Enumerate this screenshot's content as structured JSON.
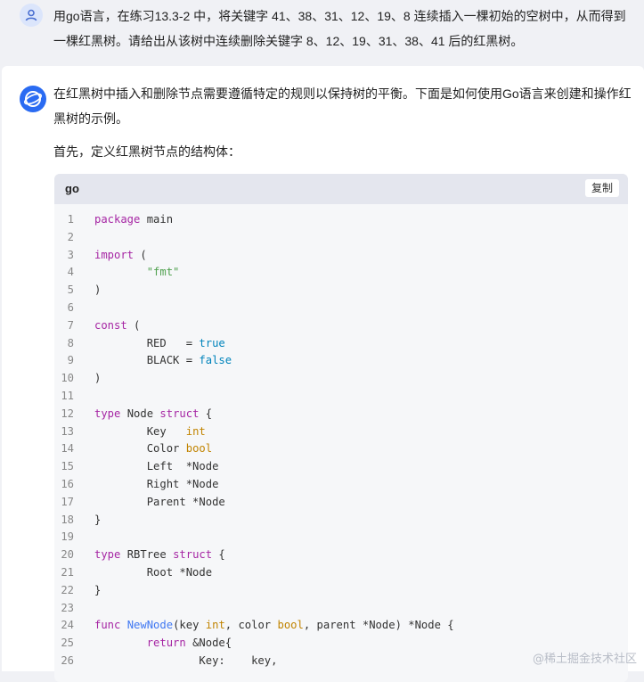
{
  "user_message": {
    "avatar_icon": "user-icon",
    "text": "用go语言，在练习13.3-2 中，将关键字 41、38、31、12、19、8 连续插入一棵初始的空树中，从而得到一棵红黑树。请给出从该树中连续删除关键字 8、12、19、31、38、41 后的红黑树。"
  },
  "bot_message": {
    "avatar_icon": "assistant-logo-icon",
    "intro": "在红黑树中插入和删除节点需要遵循特定的规则以保持树的平衡。下面是如何使用Go语言来创建和操作红黑树的示例。",
    "intro2": "首先，定义红黑树节点的结构体："
  },
  "code_block": {
    "language": "go",
    "copy_label": "复制",
    "lines": [
      {
        "n": "1",
        "tokens": [
          {
            "t": "package",
            "c": "kw"
          },
          {
            "t": " main",
            "c": "p"
          }
        ]
      },
      {
        "n": "2",
        "tokens": []
      },
      {
        "n": "3",
        "tokens": [
          {
            "t": "import",
            "c": "kw"
          },
          {
            "t": " (",
            "c": "p"
          }
        ]
      },
      {
        "n": "4",
        "tokens": [
          {
            "t": "        ",
            "c": "p"
          },
          {
            "t": "\"fmt\"",
            "c": "str"
          }
        ]
      },
      {
        "n": "5",
        "tokens": [
          {
            "t": ")",
            "c": "p"
          }
        ]
      },
      {
        "n": "6",
        "tokens": []
      },
      {
        "n": "7",
        "tokens": [
          {
            "t": "const",
            "c": "kw"
          },
          {
            "t": " (",
            "c": "p"
          }
        ]
      },
      {
        "n": "8",
        "tokens": [
          {
            "t": "        RED   = ",
            "c": "p"
          },
          {
            "t": "true",
            "c": "bool"
          }
        ]
      },
      {
        "n": "9",
        "tokens": [
          {
            "t": "        BLACK = ",
            "c": "p"
          },
          {
            "t": "false",
            "c": "bool"
          }
        ]
      },
      {
        "n": "10",
        "tokens": [
          {
            "t": ")",
            "c": "p"
          }
        ]
      },
      {
        "n": "11",
        "tokens": []
      },
      {
        "n": "12",
        "tokens": [
          {
            "t": "type",
            "c": "kw"
          },
          {
            "t": " Node ",
            "c": "p"
          },
          {
            "t": "struct",
            "c": "kw"
          },
          {
            "t": " {",
            "c": "p"
          }
        ]
      },
      {
        "n": "13",
        "tokens": [
          {
            "t": "        Key   ",
            "c": "p"
          },
          {
            "t": "int",
            "c": "type"
          }
        ]
      },
      {
        "n": "14",
        "tokens": [
          {
            "t": "        Color ",
            "c": "p"
          },
          {
            "t": "bool",
            "c": "type"
          }
        ]
      },
      {
        "n": "15",
        "tokens": [
          {
            "t": "        Left  *Node",
            "c": "p"
          }
        ]
      },
      {
        "n": "16",
        "tokens": [
          {
            "t": "        Right *Node",
            "c": "p"
          }
        ]
      },
      {
        "n": "17",
        "tokens": [
          {
            "t": "        Parent *Node",
            "c": "p"
          }
        ]
      },
      {
        "n": "18",
        "tokens": [
          {
            "t": "}",
            "c": "p"
          }
        ]
      },
      {
        "n": "19",
        "tokens": []
      },
      {
        "n": "20",
        "tokens": [
          {
            "t": "type",
            "c": "kw"
          },
          {
            "t": " RBTree ",
            "c": "p"
          },
          {
            "t": "struct",
            "c": "kw"
          },
          {
            "t": " {",
            "c": "p"
          }
        ]
      },
      {
        "n": "21",
        "tokens": [
          {
            "t": "        Root *Node",
            "c": "p"
          }
        ]
      },
      {
        "n": "22",
        "tokens": [
          {
            "t": "}",
            "c": "p"
          }
        ]
      },
      {
        "n": "23",
        "tokens": []
      },
      {
        "n": "24",
        "tokens": [
          {
            "t": "func",
            "c": "kw"
          },
          {
            "t": " ",
            "c": "p"
          },
          {
            "t": "NewNode",
            "c": "fn"
          },
          {
            "t": "(key ",
            "c": "p"
          },
          {
            "t": "int",
            "c": "type"
          },
          {
            "t": ", color ",
            "c": "p"
          },
          {
            "t": "bool",
            "c": "type"
          },
          {
            "t": ", parent *Node) *Node {",
            "c": "p"
          }
        ]
      },
      {
        "n": "25",
        "tokens": [
          {
            "t": "        ",
            "c": "p"
          },
          {
            "t": "return",
            "c": "kw"
          },
          {
            "t": " &Node{",
            "c": "p"
          }
        ]
      },
      {
        "n": "26",
        "tokens": [
          {
            "t": "                Key:    key,",
            "c": "p"
          }
        ]
      }
    ]
  },
  "watermark": "@稀土掘金技术社区"
}
